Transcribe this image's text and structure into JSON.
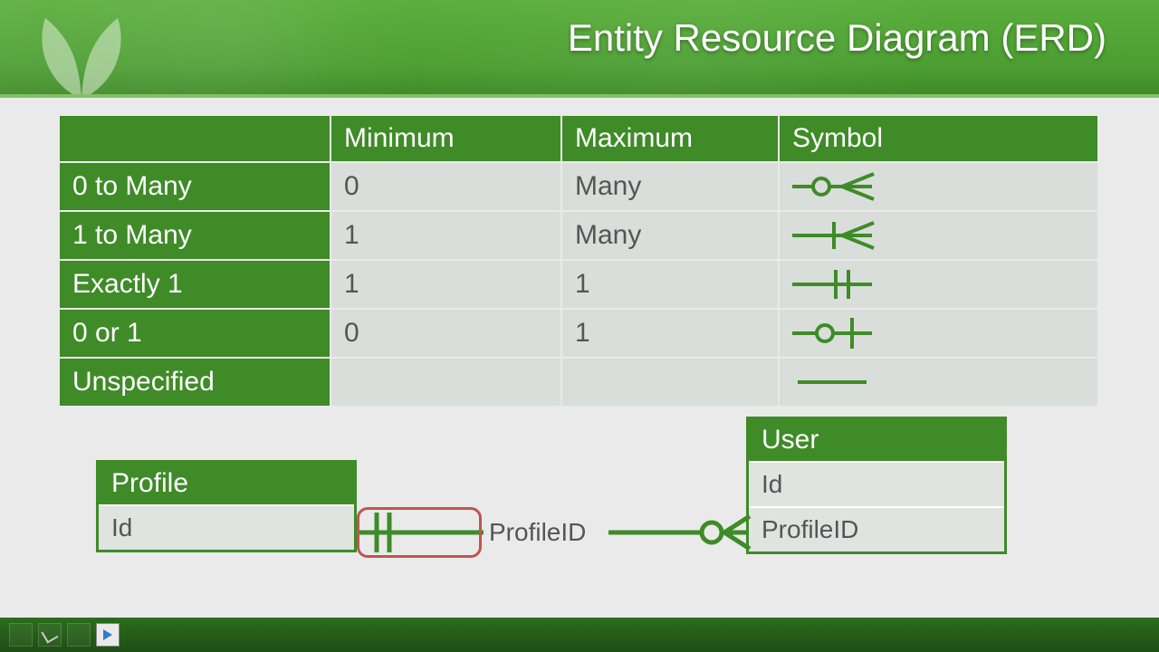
{
  "header": {
    "title": "Entity Resource Diagram (ERD)"
  },
  "table": {
    "headers": {
      "c0": "",
      "c1": "Minimum",
      "c2": "Maximum",
      "c3": "Symbol"
    },
    "rows": [
      {
        "name": "0 to Many",
        "min": "0",
        "max": "Many",
        "symbol": "zero-to-many"
      },
      {
        "name": "1 to Many",
        "min": "1",
        "max": "Many",
        "symbol": "one-to-many"
      },
      {
        "name": "Exactly 1",
        "min": "1",
        "max": "1",
        "symbol": "exactly-one"
      },
      {
        "name": "0 or 1",
        "min": "0",
        "max": "1",
        "symbol": "zero-or-one"
      },
      {
        "name": "Unspecified",
        "min": "",
        "max": "",
        "symbol": "unspecified"
      }
    ]
  },
  "erd": {
    "profile": {
      "title": "Profile",
      "field0": "Id"
    },
    "user": {
      "title": "User",
      "field0": "Id",
      "field1": "ProfileID"
    },
    "relationship_label": "ProfileID",
    "left_symbol": "exactly-one",
    "right_symbol": "zero-to-many"
  },
  "colors": {
    "brand": "#3f8b28",
    "highlight": "#c0544f"
  }
}
